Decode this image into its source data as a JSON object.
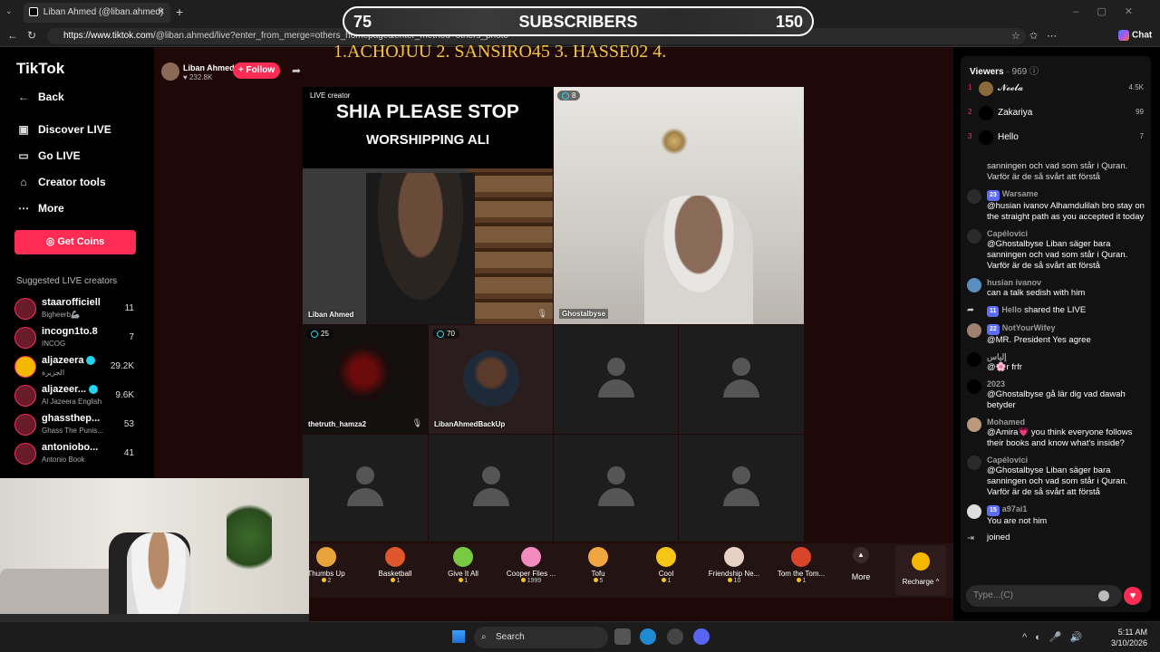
{
  "browser": {
    "tab_title": "Liban Ahmed (@liban.ahmed)",
    "tab_close": "✕",
    "new_tab": "+",
    "url_host": "https://www.tiktok.com",
    "url_path": "/@liban.ahmed/live?enter_from_merge=others_homepage&enter_method=others_photo",
    "chat_label": "Chat"
  },
  "overlay": {
    "subs_current": "75",
    "subs_label": "SUBSCRIBERS",
    "subs_goal": "150",
    "ranking": "1.ACHOJUU  2. SANSIRO45  3. HASSE02 4."
  },
  "sidebar": {
    "logo": "TikTok",
    "back": "Back",
    "nav": [
      "Discover LIVE",
      "Go LIVE",
      "Creator tools",
      "More"
    ],
    "get_coins": "Get Coins",
    "suggested_title": "Suggested LIVE creators",
    "suggested": [
      {
        "name": "staarofficiell",
        "sub": "Bigheerb🦾",
        "count": "11"
      },
      {
        "name": "incogn1to.8",
        "sub": "INCOG",
        "count": "7"
      },
      {
        "name": "aljazeera",
        "sub": "الجزيرة",
        "count": "29.2K"
      },
      {
        "name": "aljazeer...",
        "sub": "Al Jazeera English",
        "count": "9.6K"
      },
      {
        "name": "ghassthep...",
        "sub": "Ghass The Punis...",
        "count": "53"
      },
      {
        "name": "antoniobo...",
        "sub": "Antonio Book",
        "count": "41"
      }
    ]
  },
  "host": {
    "name": "Liban Ahmed",
    "likes": "♥ 232.8K",
    "follow": "+ Follow"
  },
  "grid": {
    "v1_badge": "LIVE creator",
    "v1_headline1": "SHIA PLEASE STOP",
    "v1_headline2": "WORSHIPPING ALI",
    "v1_name": "Liban Ahmed",
    "v2_count": "8",
    "v2_name": "Ghostalbyse",
    "v3_count": "25",
    "v3_name": "thetruth_hamza2",
    "v4_count": "70",
    "v4_name": "LibanAhmedBackUp"
  },
  "gifts": [
    {
      "name": "Thumbs Up",
      "cost": "2",
      "color": "#e8a33b"
    },
    {
      "name": "Basketball",
      "cost": "1",
      "color": "#e0562c"
    },
    {
      "name": "Give It All",
      "cost": "1",
      "color": "#7ac943"
    },
    {
      "name": "Cooper Flies ...",
      "cost": "1999",
      "color": "#f28cc0"
    },
    {
      "name": "Tofu",
      "cost": "5",
      "color": "#f0a640"
    },
    {
      "name": "Cool",
      "cost": "1",
      "color": "#f5c518"
    },
    {
      "name": "Friendship Ne...",
      "cost": "10",
      "color": "#e6d2c4"
    },
    {
      "name": "Tom the Tom...",
      "cost": "1",
      "color": "#d9452b"
    }
  ],
  "gift_more": "More",
  "recharge": "Recharge ^",
  "viewers": {
    "label": "Viewers",
    "count": "· 969",
    "top": [
      {
        "rank": "1",
        "name": "𝓝𝓮𝓮𝓵𝓪",
        "score": "4.5K"
      },
      {
        "rank": "2",
        "name": "Zakariya",
        "score": "99"
      },
      {
        "rank": "3",
        "name": "Hello",
        "score": "7"
      }
    ]
  },
  "chat": [
    {
      "user": "",
      "badge": "",
      "text": "sanningen och vad som står i Quran. Varför är de så svårt att förstå"
    },
    {
      "user": "Warsame",
      "badge": "23",
      "text": "@husian ivanov Alhamdulilah bro stay on the straight path as you accepted it today"
    },
    {
      "user": "Capélovici",
      "badge": "",
      "text": "@Ghostalbyse Liban säger bara sanningen och vad som står i Quran. Varför är de så svårt att förstå"
    },
    {
      "user": "husian ivanov",
      "badge": "",
      "text": "can a talk sedish with him"
    },
    {
      "user": "Hello",
      "badge": "11",
      "text": "shared the LIVE"
    },
    {
      "user": "NotYourWifey",
      "badge": "22",
      "text": "@MR. President Yes agree"
    },
    {
      "user": "إلياس",
      "badge": "",
      "text": "@🌸r frfr"
    },
    {
      "user": "2023",
      "badge": "",
      "text": "@Ghostalbyse gå lär dig vad dawah betyder"
    },
    {
      "user": "Mohamed",
      "badge": "",
      "text": "@Amira💗 you think everyone follows their books and know what's inside?"
    },
    {
      "user": "Capélovici",
      "badge": "",
      "text": "@Ghostalbyse Liban säger bara sanningen och vad som står i Quran. Varför är de så svårt att förstå"
    },
    {
      "user": "a97ai1",
      "badge": "15",
      "text": "You are not him"
    },
    {
      "user": "",
      "badge": "",
      "text": "joined"
    }
  ],
  "chat_input_placeholder": "Type...(C)",
  "taskbar": {
    "search": "Search",
    "time": "5:11 AM",
    "date": "3/10/2026"
  }
}
